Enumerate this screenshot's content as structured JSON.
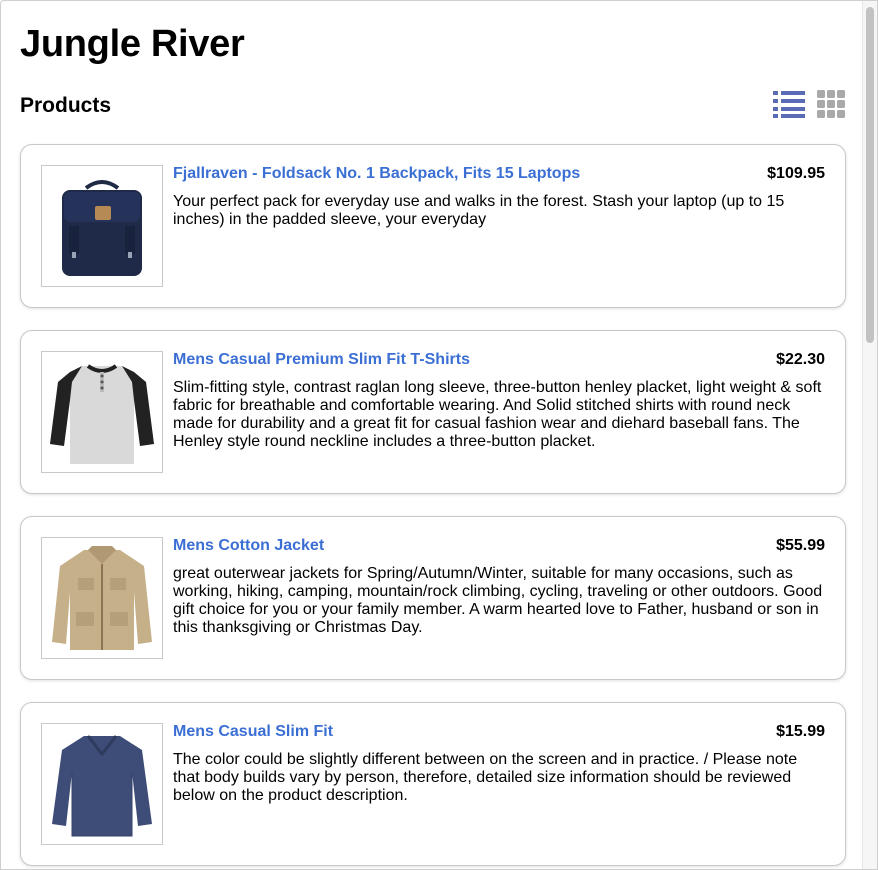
{
  "site": {
    "title": "Jungle River"
  },
  "section": {
    "title": "Products"
  },
  "view_toggle": {
    "list_icon": "list-view-icon",
    "grid_icon": "grid-view-icon",
    "active": "list",
    "active_color": "#5b6bb5",
    "inactive_color": "#a9a9a9"
  },
  "products": [
    {
      "title": "Fjallraven - Foldsack No. 1 Backpack, Fits 15 Laptops",
      "price": "$109.95",
      "description": "Your perfect pack for everyday use and walks in the forest. Stash your laptop (up to 15 inches) in the padded sleeve, your everyday",
      "image": "backpack-image"
    },
    {
      "title": "Mens Casual Premium Slim Fit T-Shirts",
      "price": "$22.30",
      "description": "Slim-fitting style, contrast raglan long sleeve, three-button henley placket, light weight & soft fabric for breathable and comfortable wearing. And Solid stitched shirts with round neck made for durability and a great fit for casual fashion wear and diehard baseball fans. The Henley style round neckline includes a three-button placket.",
      "image": "tshirt-image"
    },
    {
      "title": "Mens Cotton Jacket",
      "price": "$55.99",
      "description": "great outerwear jackets for Spring/Autumn/Winter, suitable for many occasions, such as working, hiking, camping, mountain/rock climbing, cycling, traveling or other outdoors. Good gift choice for you or your family member. A warm hearted love to Father, husband or son in this thanksgiving or Christmas Day.",
      "image": "jacket-image"
    },
    {
      "title": "Mens Casual Slim Fit",
      "price": "$15.99",
      "description": "The color could be slightly different between on the screen and in practice. / Please note that body builds vary by person, therefore, detailed size information should be reviewed below on the product description.",
      "image": "long-sleeve-shirt-image"
    }
  ],
  "colors": {
    "link": "#3b6fd4",
    "card_border": "#c8c8c8"
  }
}
